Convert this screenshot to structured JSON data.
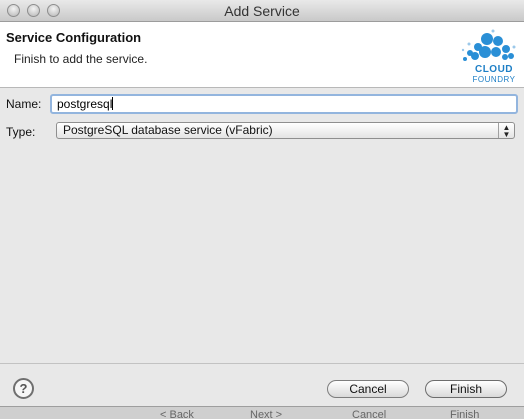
{
  "window": {
    "title": "Add Service"
  },
  "header": {
    "title": "Service Configuration",
    "subtitle": "Finish to add the service.",
    "logo_line1": "CLOUD",
    "logo_line2": "FOUNDRY"
  },
  "form": {
    "name_label": "Name:",
    "name_value": "postgresql",
    "type_label": "Type:",
    "type_value": "PostgreSQL database service (vFabric)"
  },
  "footer": {
    "help_glyph": "?",
    "cancel_label": "Cancel",
    "finish_label": "Finish"
  },
  "background_dialog": {
    "back_label": "< Back",
    "next_label": "Next >",
    "cancel_label": "Cancel",
    "finish_label": "Finish"
  },
  "colors": {
    "accent": "#1e7fc6",
    "focus_ring": "#93b5de"
  }
}
